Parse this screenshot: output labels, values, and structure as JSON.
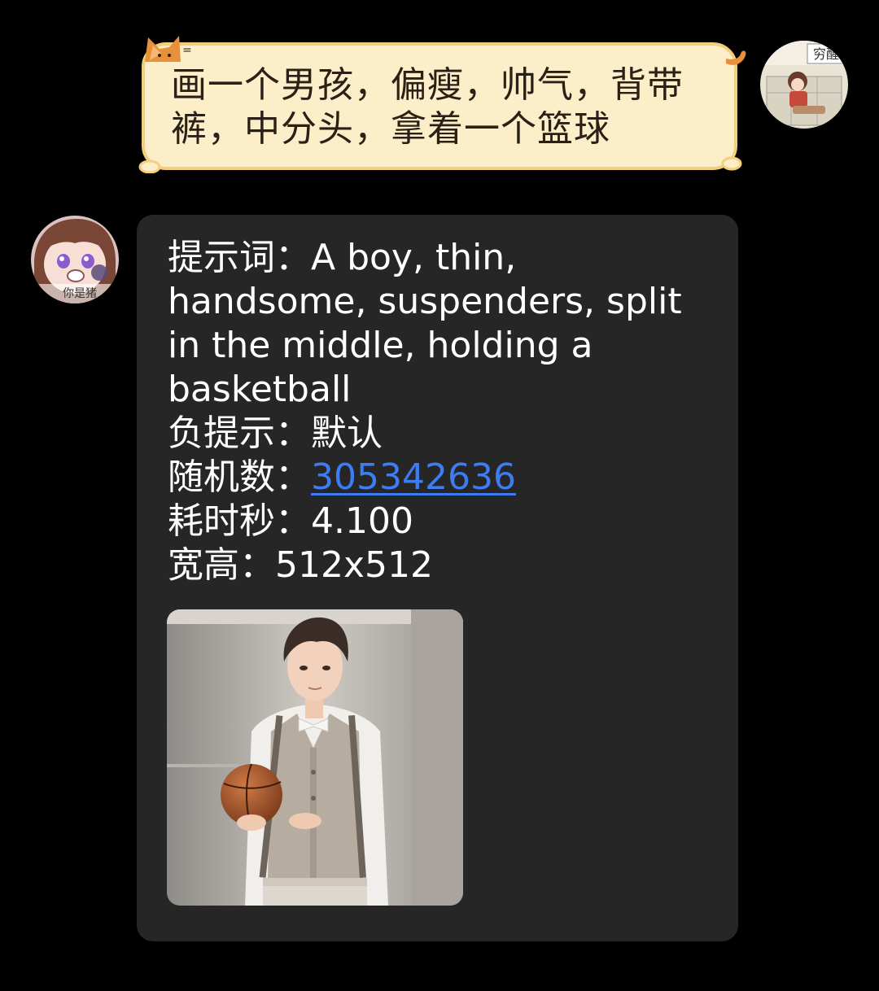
{
  "user_message": {
    "text": "画一个男孩，偏瘦，帅气，背带裤，中分头，拿着一个篮球",
    "bubble_color": "#fbeec9",
    "bubble_border_color": "#f3cf7c",
    "text_color": "#2a2016"
  },
  "user_avatar": {
    "icon": "anime-avatar-icon",
    "caption": "穷醒"
  },
  "bot_avatar": {
    "icon": "anime-avatar-icon",
    "caption": "你是猪"
  },
  "bot_message": {
    "bubble_color": "#262626",
    "prompt_label": "提示词：",
    "prompt_value": "A boy, thin, handsome, suspenders, split in the middle, holding a basketball",
    "negative_label": "负提示：",
    "negative_value": "默认",
    "seed_label": "随机数：",
    "seed_value": "305342636",
    "seed_color": "#3d7cf2",
    "time_label": "耗时秒：",
    "time_value": "4.100",
    "size_label": "宽高：",
    "size_value": "512x512",
    "image": {
      "icon": "generated-image-boy-basketball"
    }
  }
}
